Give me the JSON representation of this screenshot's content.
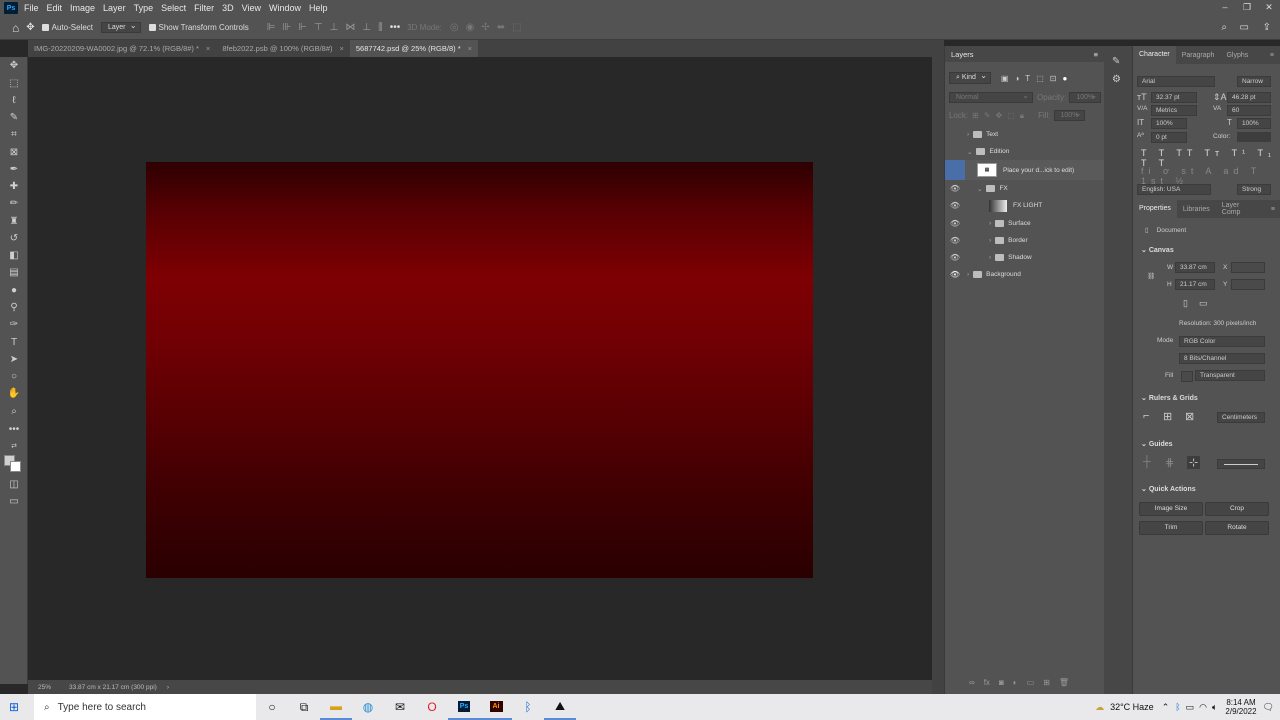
{
  "menu": {
    "app_icon": "Ps",
    "items": [
      "File",
      "Edit",
      "Image",
      "Layer",
      "Type",
      "Select",
      "Filter",
      "3D",
      "View",
      "Window",
      "Help"
    ]
  },
  "options": {
    "auto_select": "Auto-Select",
    "layer_select": "Layer",
    "show_transform": "Show Transform Controls",
    "mode_3d": "3D Mode:"
  },
  "tabs": [
    {
      "label": "IMG-20220209-WA0002.jpg @ 72.1% (RGB/8#) *"
    },
    {
      "label": "8feb2022.psb @ 100% (RGB/8#)"
    },
    {
      "label": "5687742.psd @ 25% (RGB/8) *"
    }
  ],
  "status": {
    "zoom": "25%",
    "doc_size": "33.87 cm x 21.17 cm (300 ppi)"
  },
  "layers_panel": {
    "title": "Layers",
    "kind": "Kind",
    "blend": "Normal",
    "opacity_label": "Opacity:",
    "opacity": "100%",
    "lock_label": "Lock:",
    "fill_label": "Fill:",
    "fill": "100%",
    "layers": [
      {
        "name": "Text"
      },
      {
        "name": "Edition"
      },
      {
        "name": "Place your d...ick to edit)"
      },
      {
        "name": "FX"
      },
      {
        "name": "FX LIGHT"
      },
      {
        "name": "Surface"
      },
      {
        "name": "Border"
      },
      {
        "name": "Shadow"
      },
      {
        "name": "Background"
      }
    ]
  },
  "character": {
    "tabs": [
      "Character",
      "Paragraph",
      "Glyphs"
    ],
    "font": "Arial",
    "style": "Narrow",
    "size": "32.37 pt",
    "leading": "46.28 pt",
    "kerning": "Metrics",
    "tracking": "60",
    "vscale": "100%",
    "hscale": "100%",
    "baseline": "0 pt",
    "color_label": "Color:",
    "language": "English: USA",
    "aa": "Strong"
  },
  "properties": {
    "tabs": [
      "Properties",
      "Libraries",
      "Layer Comp"
    ],
    "doc": "Document",
    "canvas": "Canvas",
    "w_label": "W",
    "w": "33.87 cm",
    "h_label": "H",
    "h": "21.17 cm",
    "x_label": "X",
    "y_label": "Y",
    "resolution": "Resolution: 300 pixels/inch",
    "mode_label": "Mode",
    "mode": "RGB Color",
    "bits": "8 Bits/Channel",
    "fill_label": "Fill",
    "fill": "Transparent",
    "rulers": "Rulers & Grids",
    "units": "Centimeters",
    "guides": "Guides",
    "quick": "Quick Actions",
    "buttons": [
      "Image Size",
      "Crop",
      "Trim",
      "Rotate"
    ]
  },
  "taskbar": {
    "search": "Type here to search",
    "weather": "32°C  Haze",
    "time": "8:14 AM",
    "date": "2/9/2022"
  }
}
